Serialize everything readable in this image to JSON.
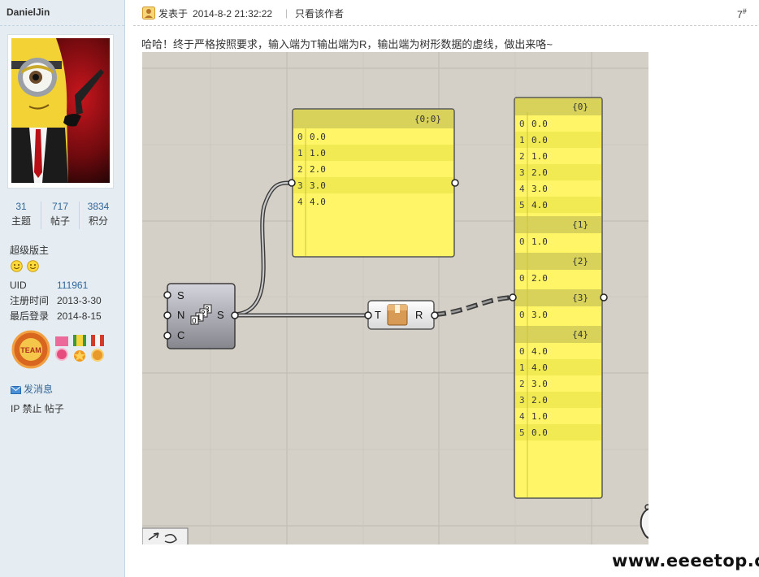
{
  "author": {
    "username": "DanielJin",
    "stats": [
      {
        "value": "31",
        "label": "主题"
      },
      {
        "value": "717",
        "label": "帖子"
      },
      {
        "value": "3834",
        "label": "积分"
      }
    ],
    "rank": "超级版主",
    "profile": [
      {
        "key": "UID",
        "value": "111961"
      },
      {
        "key": "注册时间",
        "value": "2013-3-30"
      },
      {
        "key": "最后登录",
        "value": "2014-8-15"
      }
    ],
    "medal_badge": "TEAM",
    "send_message": "发消息",
    "admin_links": "IP 禁止 帖子"
  },
  "post": {
    "posted_label": "发表于",
    "posted_time": "2014-8-2 21:32:22",
    "separator": "|",
    "only_author": "只看该作者",
    "floor": "7",
    "floor_mark": "#",
    "text": "哈哈！终于严格按照要求，输入端为T输出端为R，输出端为树形数据的虚线，做出来咯~"
  },
  "canvas": {
    "panel1": {
      "path": "{0;0}",
      "rows": [
        [
          "0",
          "0.0"
        ],
        [
          "1",
          "1.0"
        ],
        [
          "2",
          "2.0"
        ],
        [
          "3",
          "3.0"
        ],
        [
          "4",
          "4.0"
        ]
      ]
    },
    "panel2": {
      "branches": [
        {
          "path": "{0}",
          "rows": [
            [
              "0",
              "0.0"
            ],
            [
              "1",
              "0.0"
            ],
            [
              "2",
              "1.0"
            ],
            [
              "3",
              "2.0"
            ],
            [
              "4",
              "3.0"
            ],
            [
              "5",
              "4.0"
            ]
          ]
        },
        {
          "path": "{1}",
          "rows": [
            [
              "0",
              "1.0"
            ]
          ]
        },
        {
          "path": "{2}",
          "rows": [
            [
              "0",
              "2.0"
            ]
          ]
        },
        {
          "path": "{3}",
          "rows": [
            [
              "0",
              "3.0"
            ]
          ]
        },
        {
          "path": "{4}",
          "rows": [
            [
              "0",
              "4.0"
            ],
            [
              "1",
              "4.0"
            ],
            [
              "2",
              "3.0"
            ],
            [
              "3",
              "2.0"
            ],
            [
              "4",
              "1.0"
            ],
            [
              "5",
              "0.0"
            ]
          ]
        }
      ]
    },
    "series_component": {
      "inputs": [
        "S",
        "N",
        "C"
      ],
      "output": "S",
      "icon_text": [
        "0",
        "1",
        "2",
        "3"
      ]
    },
    "tree_component": {
      "input": "T",
      "output": "R"
    }
  },
  "watermark": "www.eeeetop.com",
  "colors": {
    "panel_yellow": "#fff566",
    "panel_header": "#d8d25a",
    "canvas": "#d4d0c8",
    "link": "#336699"
  }
}
